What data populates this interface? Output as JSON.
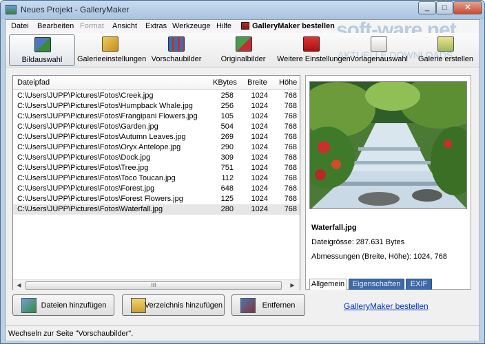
{
  "window": {
    "title": "Neues Projekt - GalleryMaker",
    "minimize": "_",
    "maximize": "□",
    "close": "✕"
  },
  "menu": {
    "items": [
      "Datei",
      "Bearbeiten",
      "Format",
      "Ansicht",
      "Extras",
      "Werkzeuge",
      "Hilfe"
    ],
    "order_link": "GalleryMaker bestellen",
    "watermark_main": "soft-ware.net",
    "watermark_sub": "AKTUELLE DOWNLOADS"
  },
  "toolbar": {
    "buttons": [
      {
        "label": "Bildauswahl",
        "icon": "image-select-icon",
        "active": true
      },
      {
        "label": "Galerieeinstellungen",
        "icon": "gallery-settings-icon",
        "active": false
      },
      {
        "label": "Vorschaubilder",
        "icon": "thumbnails-icon",
        "active": false
      },
      {
        "label": "Originalbilder",
        "icon": "original-images-icon",
        "active": false
      },
      {
        "label": "Weitere Einstellungen",
        "icon": "more-settings-icon",
        "active": false
      },
      {
        "label": "Vorlagenauswahl",
        "icon": "template-select-icon",
        "active": false
      },
      {
        "label": "Galerie erstellen",
        "icon": "create-gallery-icon",
        "active": false
      }
    ]
  },
  "filelist": {
    "columns": [
      "Dateipfad",
      "KBytes",
      "Breite",
      "Höhe"
    ],
    "rows": [
      {
        "path": "C:\\Users\\JUPP\\Pictures\\Fotos\\Creek.jpg",
        "kb": "258",
        "w": "1024",
        "h": "768"
      },
      {
        "path": "C:\\Users\\JUPP\\Pictures\\Fotos\\Humpback Whale.jpg",
        "kb": "256",
        "w": "1024",
        "h": "768"
      },
      {
        "path": "C:\\Users\\JUPP\\Pictures\\Fotos\\Frangipani Flowers.jpg",
        "kb": "105",
        "w": "1024",
        "h": "768"
      },
      {
        "path": "C:\\Users\\JUPP\\Pictures\\Fotos\\Garden.jpg",
        "kb": "504",
        "w": "1024",
        "h": "768"
      },
      {
        "path": "C:\\Users\\JUPP\\Pictures\\Fotos\\Autumn Leaves.jpg",
        "kb": "269",
        "w": "1024",
        "h": "768"
      },
      {
        "path": "C:\\Users\\JUPP\\Pictures\\Fotos\\Oryx Antelope.jpg",
        "kb": "290",
        "w": "1024",
        "h": "768"
      },
      {
        "path": "C:\\Users\\JUPP\\Pictures\\Fotos\\Dock.jpg",
        "kb": "309",
        "w": "1024",
        "h": "768"
      },
      {
        "path": "C:\\Users\\JUPP\\Pictures\\Fotos\\Tree.jpg",
        "kb": "751",
        "w": "1024",
        "h": "768"
      },
      {
        "path": "C:\\Users\\JUPP\\Pictures\\Fotos\\Toco Toucan.jpg",
        "kb": "112",
        "w": "1024",
        "h": "768"
      },
      {
        "path": "C:\\Users\\JUPP\\Pictures\\Fotos\\Forest.jpg",
        "kb": "648",
        "w": "1024",
        "h": "768"
      },
      {
        "path": "C:\\Users\\JUPP\\Pictures\\Fotos\\Forest Flowers.jpg",
        "kb": "125",
        "w": "1024",
        "h": "768"
      },
      {
        "path": "C:\\Users\\JUPP\\Pictures\\Fotos\\Waterfall.jpg",
        "kb": "280",
        "w": "1024",
        "h": "768"
      }
    ],
    "selected_index": 11,
    "scroll_left": "◀",
    "scroll_right": "▶",
    "scroll_grip": "III"
  },
  "details": {
    "filename": "Waterfall.jpg",
    "size_line": "Dateigrösse: 287.631 Bytes",
    "dims_line": "Abmessungen (Breite, Höhe): 1024, 768",
    "tabs": [
      "Allgemein",
      "Eigenschaften",
      "EXIF"
    ],
    "order_link": "GalleryMaker bestellen"
  },
  "actions": {
    "add_files": "Dateien hinzufügen",
    "add_dir": "Verzeichnis hinzufügen",
    "remove": "Entfernen"
  },
  "status": {
    "text": "Wechseln zur Seite \"Vorschaubilder\"."
  },
  "colors": {
    "accent_tab": "#3c6aa8",
    "link": "#0033cc"
  }
}
